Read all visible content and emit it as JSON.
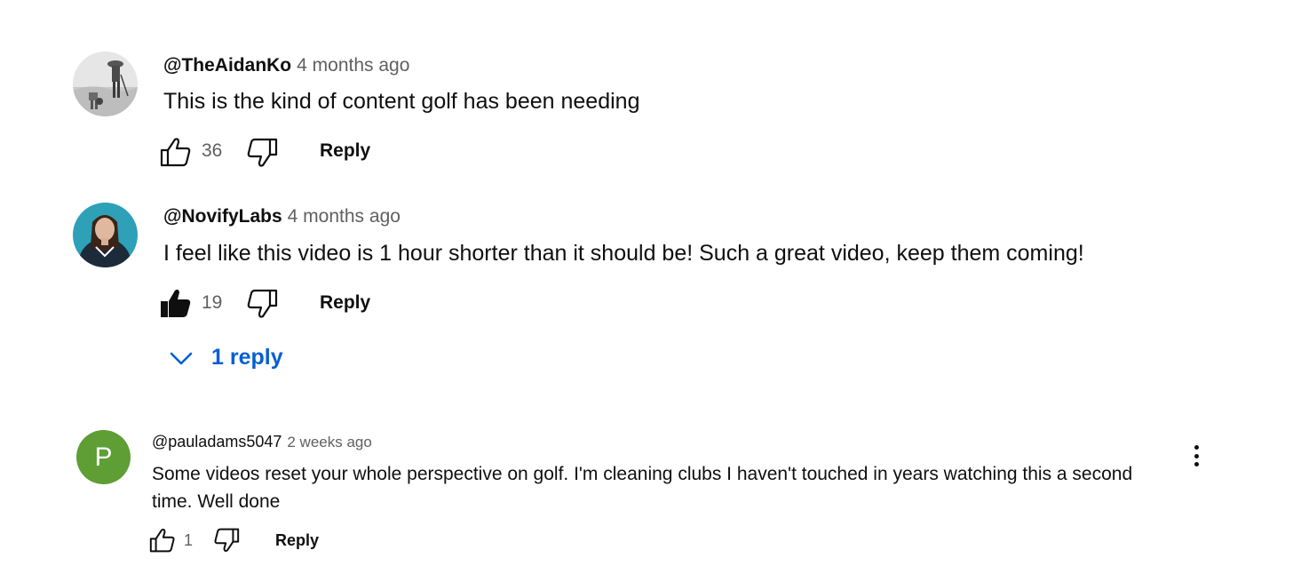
{
  "comments": [
    {
      "author": "@TheAidanKo",
      "time": "4 months ago",
      "text": "This is the kind of content golf has been needing",
      "likes": "36",
      "reply_label": "Reply",
      "liked": false,
      "avatar": "photo-avatar"
    },
    {
      "author": "@NovifyLabs",
      "time": "4 months ago",
      "text": "I feel like this video is 1 hour shorter than it should be! Such a great video, keep them coming!",
      "likes": "19",
      "reply_label": "Reply",
      "liked": true,
      "avatar": "photo-avatar",
      "replies_label": "1 reply"
    },
    {
      "author": "@pauladams5047",
      "time": "2 weeks ago",
      "text": "Some videos reset your whole perspective on golf. I'm cleaning clubs I haven't touched in years watching this a second time. Well done",
      "likes": "1",
      "reply_label": "Reply",
      "liked": false,
      "avatar_letter": "P",
      "avatar_color": "#5e9e35"
    }
  ],
  "colors": {
    "link_blue": "#065fd4",
    "secondary_text": "#606060",
    "primary_text": "#0f0f0f"
  }
}
